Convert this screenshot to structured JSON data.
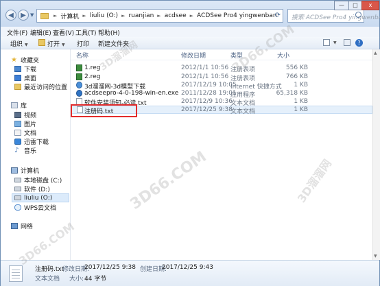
{
  "address": {
    "crumbs": [
      "计算机",
      "liuliu (O:)",
      "ruanjian",
      "acdsee",
      "ACDSee Pro4 yingwenban"
    ]
  },
  "search": {
    "placeholder": "搜索 ACDSee Pro4 yingwenban"
  },
  "window_controls": {
    "minimize": "—",
    "maximize": "□",
    "close": "x"
  },
  "menu": {
    "file": "文件(F)",
    "edit": "编辑(E)",
    "view": "查看(V)",
    "tools": "工具(T)",
    "help": "帮助(H)"
  },
  "toolbar": {
    "organize": "组织",
    "open": "打开",
    "print": "打印",
    "new_folder": "新建文件夹"
  },
  "nav": {
    "favorites": "收藏夹",
    "downloads": "下载",
    "desktop": "桌面",
    "recent": "最近访问的位置",
    "libraries": "库",
    "videos": "视频",
    "pictures": "图片",
    "documents": "文档",
    "xunlei": "迅雷下载",
    "music": "音乐",
    "computer": "计算机",
    "local_c": "本地磁盘 (C:)",
    "software_d": "软件 (D:)",
    "liuliu_o": "liuliu (O:)",
    "wps": "WPS云文档",
    "network": "网络"
  },
  "columns": {
    "name": "名称",
    "modified": "修改日期",
    "type": "类型",
    "size": "大小"
  },
  "files": [
    {
      "name": "1.reg",
      "modified": "2012/1/1 10:56",
      "type": "注册表项",
      "size": "556 KB",
      "icon": "reg-icon"
    },
    {
      "name": "2.reg",
      "modified": "2012/1/1 10:56",
      "type": "注册表项",
      "size": "766 KB",
      "icon": "reg-icon"
    },
    {
      "name": "3d溜溜网-3d模型下载",
      "modified": "2017/12/19 10:05",
      "type": "Internet 快捷方式",
      "size": "1 KB",
      "icon": "shortcut-icon"
    },
    {
      "name": "acdseepro-4-0-198-win-en.exe",
      "modified": "2011/12/28 19:01",
      "type": "应用程序",
      "size": "65,318 KB",
      "icon": "exe-icon"
    },
    {
      "name": "软件安装须知-必读.txt",
      "modified": "2017/12/9 10:36",
      "type": "文本文档",
      "size": "1 KB",
      "icon": "txt-icon"
    },
    {
      "name": "注册码.txt",
      "modified": "2017/12/25 9:38",
      "type": "文本文档",
      "size": "1 KB",
      "icon": "txt-icon"
    }
  ],
  "details": {
    "filename": "注册码.txt",
    "modified_label": "修改日期:",
    "modified": "2017/12/25 9:38",
    "created_label": "创建日期:",
    "created": "2017/12/25 9:43",
    "type": "文本文档",
    "size_label": "大小:",
    "size": "44 字节"
  },
  "watermarks": [
    "3D66.COM",
    "3D溜溜网",
    "3D66.COM",
    "3D溜溜网",
    "3D66.COM"
  ],
  "colors": {
    "selection_outline": "#e32b2b",
    "selected_row": "#e5f0fb",
    "folder": "#e9c863"
  }
}
